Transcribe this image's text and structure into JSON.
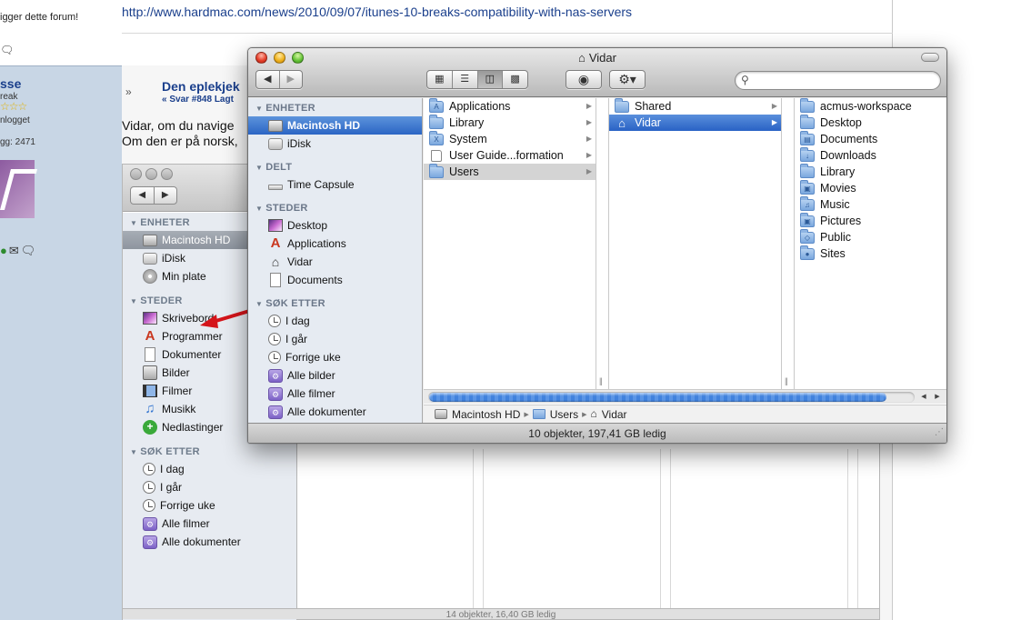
{
  "forum": {
    "link": "http://www.hardmac.com/news/2010/09/07/itunes-10-breaks-compatibility-with-nas-servers",
    "tagline": "igger dette forum!",
    "user_name": "sse",
    "user_status": "reak",
    "stars": "☆☆☆",
    "online": "nlogget",
    "posts": "gg: 2471",
    "post_title": "Den eplekjek",
    "post_sub": "« Svar #848 Lagt",
    "post_line1": "Vidar, om du navige",
    "post_line2": "Om den er på norsk,"
  },
  "bg_finder": {
    "sections": [
      {
        "label": "ENHETER",
        "items": [
          "Macintosh HD",
          "iDisk",
          "Min plate"
        ]
      },
      {
        "label": "STEDER",
        "items": [
          "Skrivebord",
          "Programmer",
          "Dokumenter",
          "Bilder",
          "Filmer",
          "Musikk",
          "Nedlastinger"
        ]
      },
      {
        "label": "SØK ETTER",
        "items": [
          "I dag",
          "I går",
          "Forrige uke",
          "Alle filmer",
          "Alle dokumenter"
        ]
      }
    ],
    "status": "14 objekter, 16,40 GB ledig"
  },
  "window": {
    "title": "Vidar",
    "search_placeholder": "",
    "sidebar": [
      {
        "label": "ENHETER",
        "items": [
          {
            "label": "Macintosh HD",
            "icon": "hd"
          },
          {
            "label": "iDisk",
            "icon": "idisk"
          }
        ]
      },
      {
        "label": "DELT",
        "items": [
          {
            "label": "Time Capsule",
            "icon": "tc"
          }
        ]
      },
      {
        "label": "STEDER",
        "items": [
          {
            "label": "Desktop",
            "icon": "desk"
          },
          {
            "label": "Applications",
            "icon": "apps"
          },
          {
            "label": "Vidar",
            "icon": "house"
          },
          {
            "label": "Documents",
            "icon": "docs"
          }
        ]
      },
      {
        "label": "SØK ETTER",
        "items": [
          {
            "label": "I dag",
            "icon": "clock"
          },
          {
            "label": "I går",
            "icon": "clock"
          },
          {
            "label": "Forrige uke",
            "icon": "clock"
          },
          {
            "label": "Alle bilder",
            "icon": "smart"
          },
          {
            "label": "Alle filmer",
            "icon": "smart"
          },
          {
            "label": "Alle dokumenter",
            "icon": "smart"
          }
        ]
      }
    ],
    "column1": [
      "Applications",
      "Library",
      "System",
      "User Guide...formation",
      "Users"
    ],
    "column2": [
      "Shared",
      "Vidar"
    ],
    "column3": [
      "acmus-workspace",
      "Desktop",
      "Documents",
      "Downloads",
      "Library",
      "Movies",
      "Music",
      "Pictures",
      "Public",
      "Sites"
    ],
    "path": [
      "Macintosh HD",
      "Users",
      "Vidar"
    ],
    "status": "10 objekter, 197,41 GB ledig"
  },
  "colors": {
    "selection_blue": "#2b65c4",
    "sidebar_bg": "#e6ebf2",
    "scroll_thumb": "#4182dd",
    "annotation_arrow": "#d4141a"
  }
}
